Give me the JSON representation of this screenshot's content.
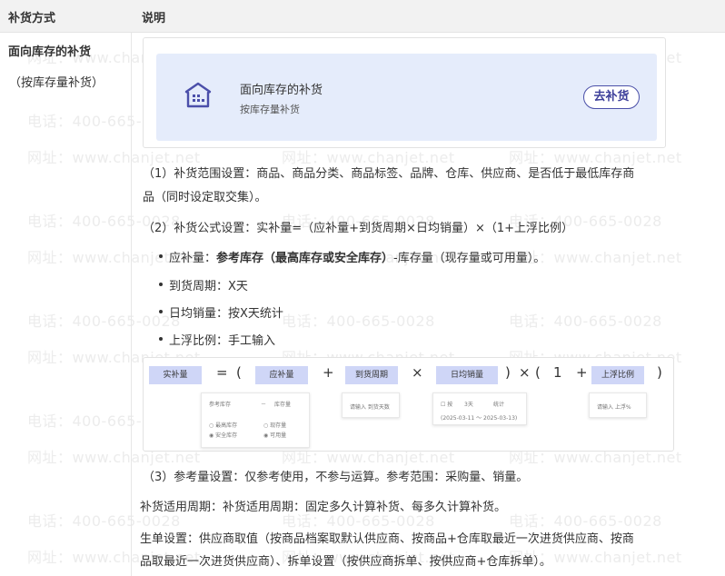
{
  "header": {
    "col1": "补货方式",
    "col2": "说明"
  },
  "left": {
    "title": "面向库存的补货",
    "subtitle": "（按库存量补货）"
  },
  "card": {
    "title": "面向库存的补货",
    "subtitle": "按库存量补货",
    "button": "去补货",
    "icon": "warehouse-icon"
  },
  "paragraphs": {
    "p1_line1": "（1）补货范围设置：商品、商品分类、商品标签、品牌、仓库、供应商、是否低于最低库存商",
    "p1_line2": "品（同时设定取交集）。",
    "p2": "（2）补货公式设置：实补量=（应补量+到货周期×日均销量）×（1+上浮比例）",
    "b1_prefix": "应补量：",
    "b1_bold": "参考库存（最高库存或安全库存）",
    "b1_suffix": "-库存量（现存量或可用量）。",
    "b2": "到货周期：X天",
    "b3": "日均销量：按X天统计",
    "b4": "上浮比例：手工输入",
    "p3": "（3）参考量设置：仅参考使用，不参与运算。参考范围：采购量、销量。",
    "p4": "补货适用周期：补货适用周期：固定多久计算补货、每多久计算补货。",
    "p5_line1": "生单设置：供应商取值（按商品档案取默认供应商、按商品+仓库取最近一次进货供应商、按商",
    "p5_line2": "品取最近一次进货供应商）、拆单设置（按供应商拆单、按供应商+仓库拆单）。"
  },
  "formula": {
    "actual": "实补量",
    "eq": "=",
    "lparen": "(",
    "should": "应补量",
    "plus": "+",
    "period": "到货周期",
    "times": "×",
    "daily": "日均销量",
    "rparen": ")",
    "times2": "×",
    "lparen2": "(",
    "one": "1",
    "plus2": "+",
    "float": "上浮比例",
    "rparen2": ")",
    "panel1": {
      "ref": "参考库存",
      "minus": "－",
      "stock": "库存量",
      "opt1": "最高库存",
      "opt2": "安全库存",
      "opt3": "现存量",
      "opt4": "可用量"
    },
    "panel2": {
      "hint": "请输入 到货天数"
    },
    "panel3": {
      "label1": "按",
      "label2": "3天",
      "label3": "统计",
      "range": "(2025-03-11 ～ 2025-03-13)"
    },
    "panel4": {
      "hint": "请输入 上浮%"
    }
  },
  "watermark": {
    "line1": "电话：400-665-0028",
    "line2": "网址：www.chanjet.net"
  }
}
